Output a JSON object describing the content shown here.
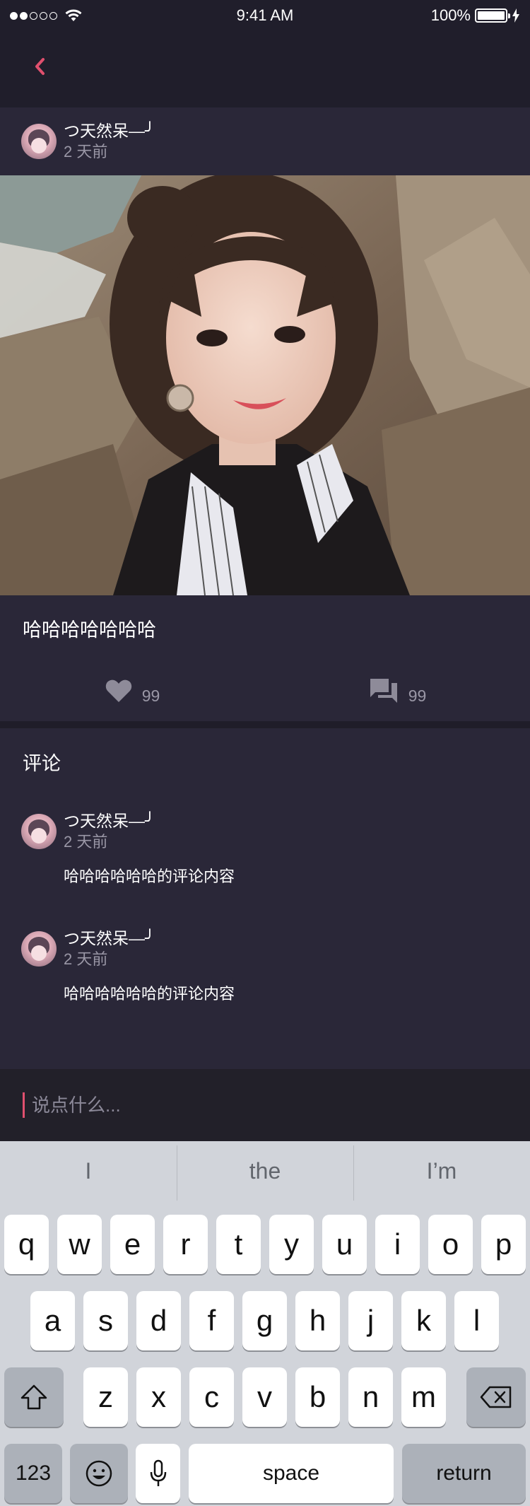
{
  "status_bar": {
    "time": "9:41 AM",
    "battery": "100%",
    "signal_icon": "signal-dots-icon",
    "wifi_icon": "wifi-icon"
  },
  "nav": {
    "back_icon": "chevron-left-icon",
    "accent_color": "#e0506e"
  },
  "post": {
    "author_name": "つ天然呆―╯",
    "author_time": "2 天前",
    "caption": "哈哈哈哈哈哈哈",
    "likes": "99",
    "comments": "99"
  },
  "comments_section": {
    "title": "评论",
    "items": [
      {
        "name": "つ天然呆―╯",
        "time": "2 天前",
        "text": "哈哈哈哈哈哈的评论内容"
      },
      {
        "name": "つ天然呆―╯",
        "time": "2 天前",
        "text": "哈哈哈哈哈哈的评论内容"
      }
    ]
  },
  "input": {
    "placeholder": "说点什么..."
  },
  "keyboard": {
    "suggestions": [
      "I",
      "the",
      "I’m"
    ],
    "row1": [
      "q",
      "w",
      "e",
      "r",
      "t",
      "y",
      "u",
      "i",
      "o",
      "p"
    ],
    "row2": [
      "a",
      "s",
      "d",
      "f",
      "g",
      "h",
      "j",
      "k",
      "l"
    ],
    "row3": [
      "z",
      "x",
      "c",
      "v",
      "b",
      "n",
      "m"
    ],
    "numbers_label": "123",
    "space_label": "space",
    "return_label": "return"
  }
}
